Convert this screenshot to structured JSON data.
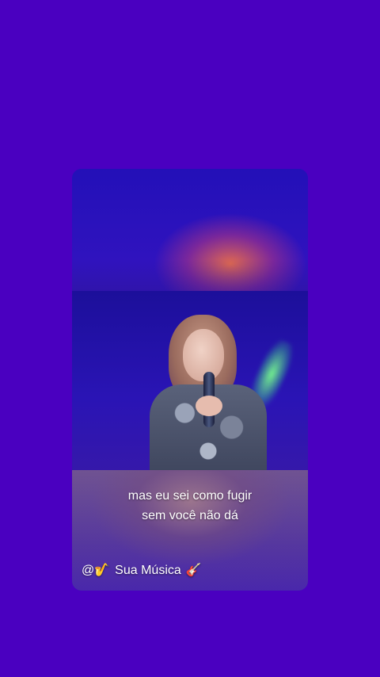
{
  "lyrics": {
    "line1": "mas eu sei como fugir",
    "line2": "sem você não dá"
  },
  "watermark": {
    "at": "@",
    "sax_emoji": "🎷",
    "label": "Sua Música",
    "guitar_emoji": "🎸"
  },
  "colors": {
    "background": "#4a00c0",
    "card": "#2a0fb0",
    "text": "#ffffff"
  }
}
